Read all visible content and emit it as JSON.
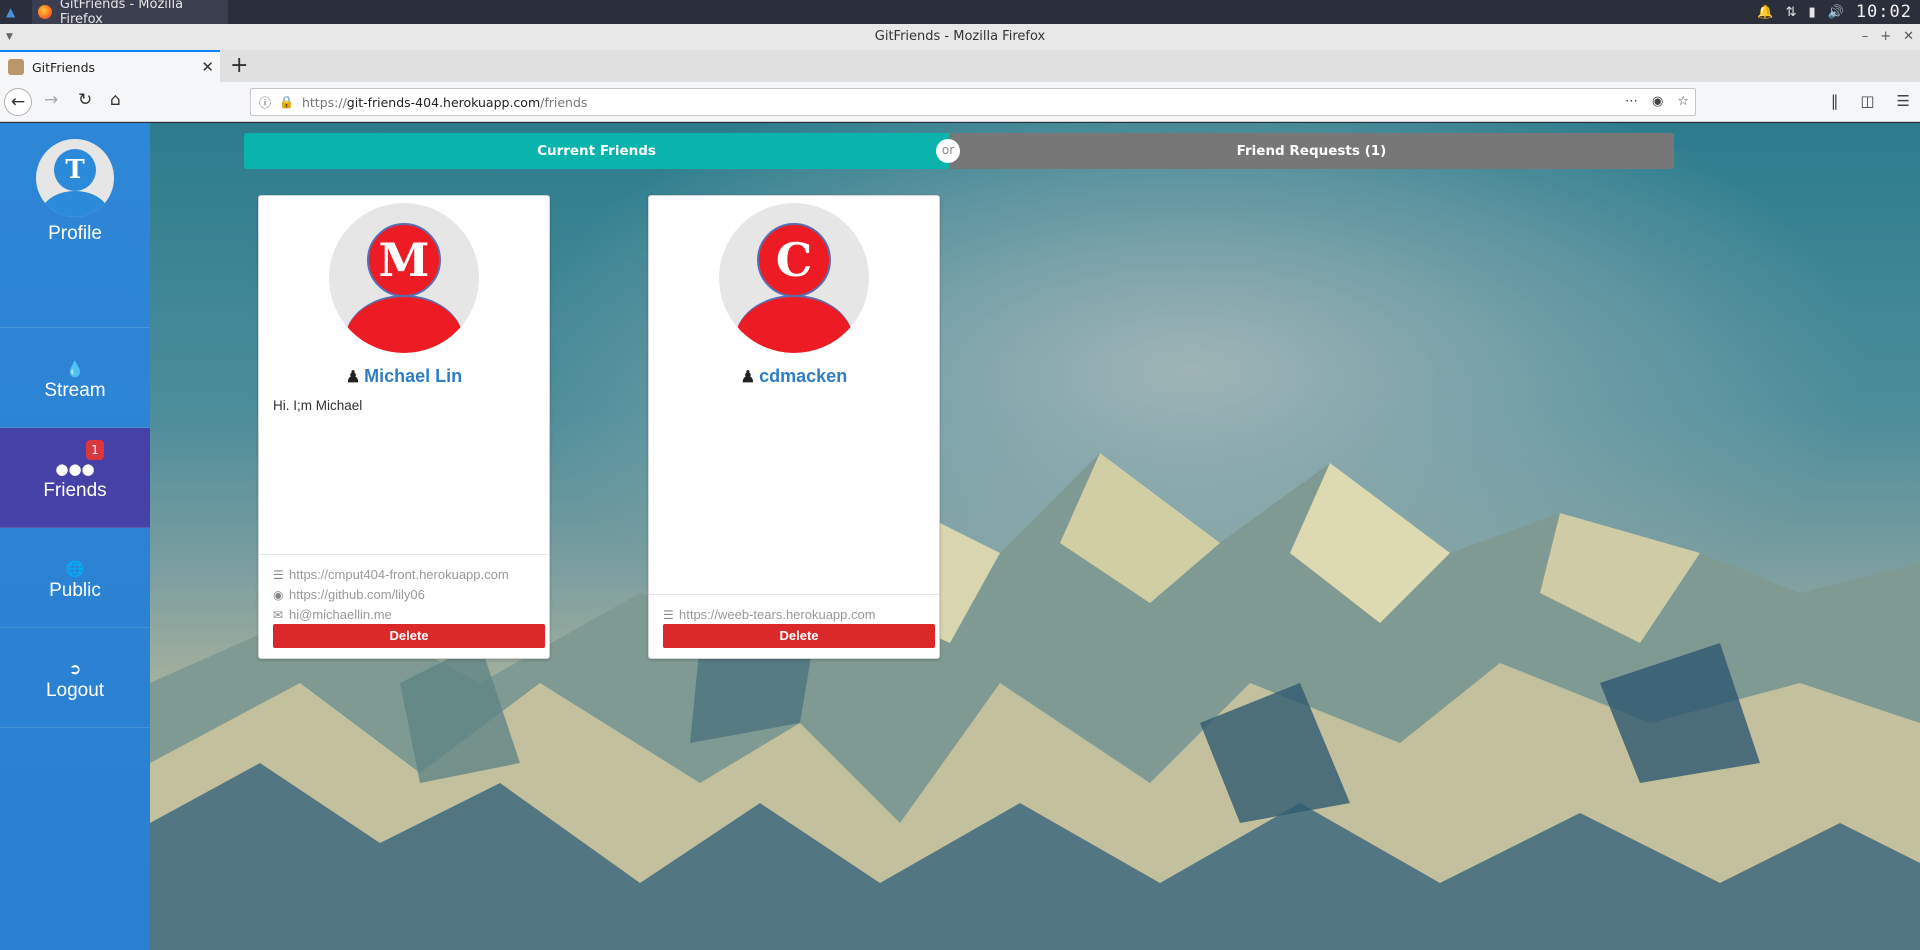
{
  "os": {
    "task_title": "GitFriends - Mozilla Firefox",
    "clock": "10:02"
  },
  "window": {
    "title": "GitFriends - Mozilla Firefox"
  },
  "browser": {
    "tab_title": "GitFriends",
    "url_scheme": "https://",
    "url_host": "git-friends-404.herokuapp.com",
    "url_path": "/friends"
  },
  "sidebar": {
    "avatar_letter": "T",
    "items": [
      {
        "label": "Profile"
      },
      {
        "label": "Stream",
        "icon": "tint-icon"
      },
      {
        "label": "Friends",
        "icon": "users-icon",
        "badge": "1"
      },
      {
        "label": "Public",
        "icon": "globe-icon"
      },
      {
        "label": "Logout",
        "icon": "sign-out-icon"
      }
    ]
  },
  "toggle": {
    "left": "Current Friends",
    "or": "or",
    "right": "Friend Requests (1)"
  },
  "friends": [
    {
      "initial": "M",
      "name": "Michael Lin",
      "description": "Hi. I;m Michael",
      "host": "https://cmput404-front.herokuapp.com",
      "github": "https://github.com/lily06",
      "email": "hi@michaellin.me",
      "delete_label": "Delete"
    },
    {
      "initial": "C",
      "name": "cdmacken",
      "host": "https://weeb-tears.herokuapp.com",
      "delete_label": "Delete"
    }
  ],
  "colors": {
    "sidebar": "#2b84d5",
    "sidebar_active": "#4541a6",
    "toggle_active": "#0ab3ac",
    "toggle_inactive": "#777777",
    "delete": "#db2828",
    "avatar": "#ed1c24",
    "name_link": "#2f7ec4"
  }
}
